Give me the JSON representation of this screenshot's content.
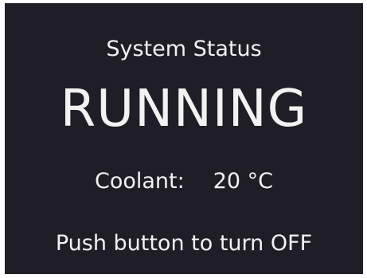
{
  "display": {
    "title": "System Status",
    "state": "RUNNING",
    "coolant_label": "Coolant:",
    "coolant_value": "20 °C",
    "hint": "Push button to turn OFF"
  },
  "colors": {
    "background": "#1f1e27",
    "text": "#f2f2f2"
  }
}
